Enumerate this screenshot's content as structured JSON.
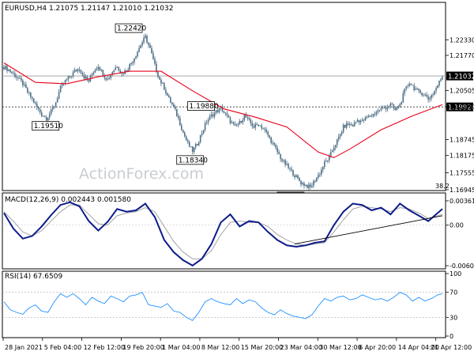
{
  "colors": {
    "candle": "#4e6f86",
    "ma": "#e8001a",
    "macd": "#0d1c8a",
    "signal": "#9a9a9a",
    "rsi": "#1e90ff",
    "frame": "#000000",
    "watermark": "#c9cdd2"
  },
  "chart_data": [
    {
      "type": "candlestick",
      "title": "EURUSD,H4  1.21075 1.21147 1.21010 1.21032",
      "watermark": "ActionForex.com",
      "y_ticks": [
        "1.22330",
        "1.21770",
        "1.20505",
        "1.19930",
        "1.18745",
        "1.18175",
        "1.17555",
        "1.16945"
      ],
      "ylim": [
        1.16945,
        1.2353
      ],
      "x_tick_labels": [
        "28 Jan 2021",
        "5 Feb 04:00",
        "12 Feb 12:00",
        "19 Feb 20:00",
        "1 Mar 04:00",
        "8 Mar 12:00",
        "15 Mar 20:00",
        "23 Mar 04:00",
        "30 Mar 12:00",
        "6 Apr 20:00",
        "14 Apr 04:00",
        "21 Apr 12:00"
      ],
      "close_path": [
        [
          0,
          1.2135
        ],
        [
          3,
          1.2125
        ],
        [
          6,
          1.211
        ],
        [
          9,
          1.2095
        ],
        [
          12,
          1.2075
        ],
        [
          15,
          1.2045
        ],
        [
          18,
          1.202
        ],
        [
          21,
          1.199
        ],
        [
          24,
          1.1965
        ],
        [
          27,
          1.1951
        ],
        [
          30,
          1.1975
        ],
        [
          33,
          1.201
        ],
        [
          36,
          1.206
        ],
        [
          39,
          1.2085
        ],
        [
          42,
          1.21
        ],
        [
          45,
          1.212
        ],
        [
          48,
          1.213
        ],
        [
          51,
          1.21
        ],
        [
          54,
          1.2085
        ],
        [
          57,
          1.212
        ],
        [
          60,
          1.214
        ],
        [
          63,
          1.211
        ],
        [
          66,
          1.209
        ],
        [
          69,
          1.212
        ],
        [
          72,
          1.214
        ],
        [
          75,
          1.211
        ],
        [
          78,
          1.2125
        ],
        [
          81,
          1.215
        ],
        [
          84,
          1.218
        ],
        [
          87,
          1.2215
        ],
        [
          90,
          1.2242
        ],
        [
          93,
          1.22
        ],
        [
          96,
          1.214
        ],
        [
          99,
          1.209
        ],
        [
          102,
          1.206
        ],
        [
          105,
          1.202
        ],
        [
          108,
          1.199
        ],
        [
          111,
          1.195
        ],
        [
          114,
          1.19
        ],
        [
          117,
          1.186
        ],
        [
          120,
          1.1834
        ],
        [
          123,
          1.186
        ],
        [
          126,
          1.19
        ],
        [
          129,
          1.194
        ],
        [
          132,
          1.196
        ],
        [
          135,
          1.1975
        ],
        [
          138,
          1.1988
        ],
        [
          141,
          1.1965
        ],
        [
          144,
          1.194
        ],
        [
          147,
          1.192
        ],
        [
          150,
          1.1935
        ],
        [
          153,
          1.196
        ],
        [
          156,
          1.194
        ],
        [
          159,
          1.192
        ],
        [
          162,
          1.193
        ],
        [
          165,
          1.1915
        ],
        [
          168,
          1.189
        ],
        [
          171,
          1.186
        ],
        [
          174,
          1.183
        ],
        [
          177,
          1.18
        ],
        [
          180,
          1.178
        ],
        [
          183,
          1.176
        ],
        [
          186,
          1.174
        ],
        [
          189,
          1.172
        ],
        [
          192,
          1.171
        ],
        [
          195,
          1.1703
        ],
        [
          198,
          1.173
        ],
        [
          201,
          1.1755
        ],
        [
          204,
          1.179
        ],
        [
          207,
          1.181
        ],
        [
          210,
          1.185
        ],
        [
          213,
          1.188
        ],
        [
          216,
          1.192
        ],
        [
          219,
          1.193
        ],
        [
          222,
          1.1925
        ],
        [
          225,
          1.1945
        ],
        [
          228,
          1.194
        ],
        [
          231,
          1.1955
        ],
        [
          234,
          1.196
        ],
        [
          237,
          1.1975
        ],
        [
          240,
          1.1985
        ],
        [
          243,
          1.199
        ],
        [
          246,
          1.2
        ],
        [
          249,
          1.198
        ],
        [
          252,
          1.2
        ],
        [
          255,
          1.205
        ],
        [
          258,
          1.208
        ],
        [
          261,
          1.206
        ],
        [
          264,
          1.2045
        ],
        [
          267,
          1.204
        ],
        [
          270,
          1.202
        ],
        [
          273,
          1.204
        ],
        [
          276,
          1.207
        ],
        [
          279,
          1.2103
        ]
      ],
      "ma_path": [
        [
          0,
          1.215
        ],
        [
          20,
          1.208
        ],
        [
          40,
          1.2075
        ],
        [
          60,
          1.21
        ],
        [
          80,
          1.212
        ],
        [
          100,
          1.212
        ],
        [
          120,
          1.205
        ],
        [
          140,
          1.1985
        ],
        [
          160,
          1.1955
        ],
        [
          180,
          1.192
        ],
        [
          200,
          1.183
        ],
        [
          210,
          1.181
        ],
        [
          220,
          1.184
        ],
        [
          240,
          1.191
        ],
        [
          260,
          1.196
        ],
        [
          279,
          1.2
        ]
      ],
      "horizontal_lines": [
        1.2103,
        1.1992
      ],
      "price_markers": [
        "1.21032",
        "1.19920"
      ],
      "annotations": [
        {
          "label": "1.22420",
          "x": 90,
          "y": 1.2242
        },
        {
          "label": "1.19510",
          "x": 27,
          "y": 1.1951
        },
        {
          "label": "1.19880",
          "x": 138,
          "y": 1.1988
        },
        {
          "label": "1.18340",
          "x": 120,
          "y": 1.1834
        },
        {
          "label": "1.17030",
          "x": 195,
          "y": 1.1703
        }
      ],
      "corner_text": "38.2"
    },
    {
      "type": "line",
      "title": "MACD(12,26,9) 0.002443 0.001580",
      "y_ticks": [
        "0.003615",
        "0.00",
        "-0.006026"
      ],
      "ylim": [
        -0.006026,
        0.003615
      ],
      "series": [
        {
          "values": [
            [
              0,
              0.0018
            ],
            [
              6,
              -0.0005
            ],
            [
              12,
              -0.002
            ],
            [
              18,
              -0.0016
            ],
            [
              24,
              -0.0002
            ],
            [
              30,
              0.0015
            ],
            [
              36,
              0.003
            ],
            [
              42,
              0.0034
            ],
            [
              48,
              0.0028
            ],
            [
              54,
              0.0006
            ],
            [
              60,
              -0.0008
            ],
            [
              66,
              0.0005
            ],
            [
              72,
              0.0024
            ],
            [
              78,
              0.002
            ],
            [
              84,
              0.0022
            ],
            [
              90,
              0.0032
            ],
            [
              96,
              0.0012
            ],
            [
              102,
              -0.0022
            ],
            [
              108,
              -0.004
            ],
            [
              114,
              -0.0052
            ],
            [
              120,
              -0.006
            ],
            [
              126,
              -0.005
            ],
            [
              132,
              -0.0028
            ],
            [
              138,
              0.0004
            ],
            [
              144,
              0.0016
            ],
            [
              150,
              -0.0002
            ],
            [
              156,
              0.0006
            ],
            [
              162,
              0.0004
            ],
            [
              168,
              -0.001
            ],
            [
              174,
              -0.0022
            ],
            [
              180,
              -0.003
            ],
            [
              186,
              -0.0032
            ],
            [
              192,
              -0.003
            ],
            [
              198,
              -0.0026
            ],
            [
              204,
              -0.0024
            ],
            [
              210,
              0.0
            ],
            [
              216,
              0.002
            ],
            [
              222,
              0.0032
            ],
            [
              228,
              0.003
            ],
            [
              234,
              0.0022
            ],
            [
              240,
              0.0026
            ],
            [
              246,
              0.0016
            ],
            [
              252,
              0.0032
            ],
            [
              258,
              0.0022
            ],
            [
              264,
              0.0014
            ],
            [
              270,
              0.0006
            ],
            [
              276,
              0.0018
            ],
            [
              279,
              0.0024
            ]
          ]
        },
        {
          "values": [
            [
              0,
              0.002
            ],
            [
              6,
              0.0006
            ],
            [
              12,
              -0.001
            ],
            [
              18,
              -0.0016
            ],
            [
              24,
              -0.0008
            ],
            [
              30,
              0.0006
            ],
            [
              36,
              0.002
            ],
            [
              42,
              0.003
            ],
            [
              48,
              0.003
            ],
            [
              54,
              0.0016
            ],
            [
              60,
              0.0002
            ],
            [
              66,
              0.0
            ],
            [
              72,
              0.0014
            ],
            [
              78,
              0.0018
            ],
            [
              84,
              0.002
            ],
            [
              90,
              0.0026
            ],
            [
              96,
              0.002
            ],
            [
              102,
              -0.0002
            ],
            [
              108,
              -0.0024
            ],
            [
              114,
              -0.004
            ],
            [
              120,
              -0.005
            ],
            [
              126,
              -0.005
            ],
            [
              132,
              -0.0038
            ],
            [
              138,
              -0.0014
            ],
            [
              144,
              0.0004
            ],
            [
              150,
              0.0006
            ],
            [
              156,
              0.0004
            ],
            [
              162,
              0.0004
            ],
            [
              168,
              -0.0002
            ],
            [
              174,
              -0.0014
            ],
            [
              180,
              -0.0022
            ],
            [
              186,
              -0.0028
            ],
            [
              192,
              -0.003
            ],
            [
              198,
              -0.0028
            ],
            [
              204,
              -0.0026
            ],
            [
              210,
              -0.001
            ],
            [
              216,
              0.0008
            ],
            [
              222,
              0.0024
            ],
            [
              228,
              0.0028
            ],
            [
              234,
              0.0026
            ],
            [
              240,
              0.0024
            ],
            [
              246,
              0.002
            ],
            [
              252,
              0.0026
            ],
            [
              258,
              0.0024
            ],
            [
              264,
              0.0018
            ],
            [
              270,
              0.001
            ],
            [
              276,
              0.0014
            ],
            [
              279,
              0.0016
            ]
          ]
        }
      ],
      "trendline": [
        [
          185,
          -0.0028
        ],
        [
          279,
          0.0014
        ]
      ]
    },
    {
      "type": "line",
      "title": "RSI(14) 67.6509",
      "y_ticks": [
        "100",
        "70",
        "30",
        "0"
      ],
      "ylim": [
        0,
        100
      ],
      "series": [
        {
          "values": [
            [
              0,
              55
            ],
            [
              4,
              42
            ],
            [
              8,
              38
            ],
            [
              12,
              35
            ],
            [
              16,
              45
            ],
            [
              20,
              50
            ],
            [
              24,
              40
            ],
            [
              28,
              38
            ],
            [
              32,
              55
            ],
            [
              36,
              68
            ],
            [
              40,
              62
            ],
            [
              44,
              68
            ],
            [
              48,
              60
            ],
            [
              52,
              50
            ],
            [
              56,
              62
            ],
            [
              60,
              56
            ],
            [
              64,
              52
            ],
            [
              68,
              64
            ],
            [
              72,
              60
            ],
            [
              76,
              55
            ],
            [
              80,
              64
            ],
            [
              84,
              66
            ],
            [
              88,
              70
            ],
            [
              92,
              50
            ],
            [
              96,
              48
            ],
            [
              100,
              46
            ],
            [
              104,
              52
            ],
            [
              108,
              40
            ],
            [
              112,
              38
            ],
            [
              116,
              30
            ],
            [
              120,
              25
            ],
            [
              124,
              38
            ],
            [
              128,
              55
            ],
            [
              132,
              60
            ],
            [
              136,
              55
            ],
            [
              140,
              52
            ],
            [
              144,
              50
            ],
            [
              148,
              60
            ],
            [
              152,
              52
            ],
            [
              156,
              58
            ],
            [
              160,
              55
            ],
            [
              164,
              45
            ],
            [
              168,
              38
            ],
            [
              172,
              34
            ],
            [
              176,
              42
            ],
            [
              180,
              36
            ],
            [
              184,
              32
            ],
            [
              188,
              30
            ],
            [
              192,
              28
            ],
            [
              196,
              34
            ],
            [
              200,
              48
            ],
            [
              204,
              60
            ],
            [
              208,
              56
            ],
            [
              212,
              62
            ],
            [
              216,
              64
            ],
            [
              220,
              58
            ],
            [
              224,
              60
            ],
            [
              228,
              66
            ],
            [
              232,
              62
            ],
            [
              236,
              58
            ],
            [
              240,
              60
            ],
            [
              244,
              56
            ],
            [
              248,
              62
            ],
            [
              252,
              70
            ],
            [
              256,
              66
            ],
            [
              260,
              56
            ],
            [
              264,
              62
            ],
            [
              268,
              56
            ],
            [
              272,
              60
            ],
            [
              276,
              66
            ],
            [
              279,
              68
            ]
          ]
        }
      ],
      "reference_levels": [
        70,
        30
      ]
    }
  ]
}
